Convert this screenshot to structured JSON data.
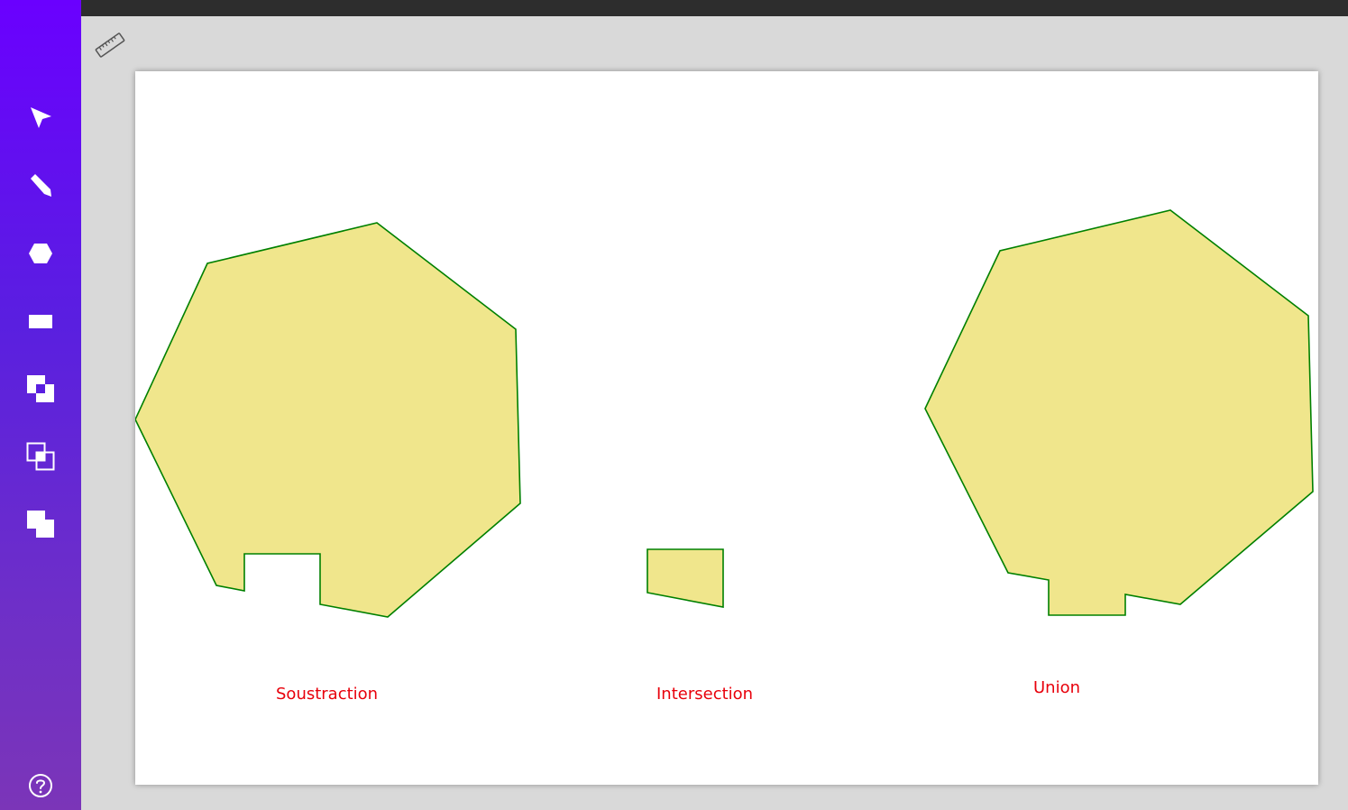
{
  "sidebar": {
    "tools": [
      {
        "icon": "cursor-icon"
      },
      {
        "icon": "pen-icon"
      },
      {
        "icon": "hexagon-icon"
      },
      {
        "icon": "rectangle-icon"
      },
      {
        "icon": "subtract-icon"
      },
      {
        "icon": "intersect-icon"
      },
      {
        "icon": "union-icon"
      }
    ],
    "help_icon": "help-icon"
  },
  "toolbar": {
    "ruler_icon": "ruler-icon"
  },
  "canvas": {
    "shape_fill": "#f0e68c",
    "shape_stroke": "#008000",
    "caption_color": "#e8000b",
    "captions": {
      "subtraction": "Soustraction",
      "intersection": "Intersection",
      "union": "Union"
    }
  }
}
